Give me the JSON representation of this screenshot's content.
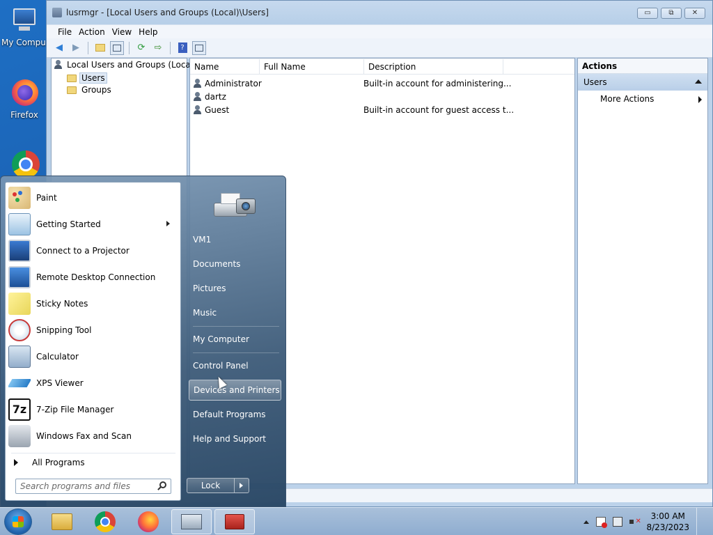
{
  "desktop": {
    "icons": [
      {
        "label": "My Computer",
        "icon": "computer-icon"
      },
      {
        "label": "Firefox",
        "icon": "firefox-icon"
      },
      {
        "label": "",
        "icon": "chrome-icon"
      }
    ]
  },
  "window": {
    "title": "lusrmgr - [Local Users and Groups (Local)\\Users]",
    "controls": {
      "minimize": "▭",
      "restore": "⧉",
      "close": "✕"
    },
    "menu": [
      "File",
      "Action",
      "View",
      "Help"
    ],
    "toolbar": [
      "back-icon",
      "forward-icon",
      "up-folder-icon",
      "show-tree-icon",
      "refresh-icon",
      "export-icon",
      "help-icon",
      "show-action-pane-icon"
    ]
  },
  "tree": {
    "root": "Local Users and Groups (Local)",
    "children": [
      "Users",
      "Groups"
    ],
    "selected": "Users"
  },
  "list": {
    "columns": [
      "Name",
      "Full Name",
      "Description"
    ],
    "rows": [
      {
        "name": "Administrator",
        "full_name": "",
        "description": "Built-in account for administering..."
      },
      {
        "name": "dartz",
        "full_name": "",
        "description": ""
      },
      {
        "name": "Guest",
        "full_name": "",
        "description": "Built-in account for guest access t..."
      }
    ]
  },
  "actions": {
    "header": "Actions",
    "section": "Users",
    "items": [
      "More Actions"
    ]
  },
  "start_menu": {
    "programs": [
      {
        "label": "Paint",
        "icon": "paint-icon",
        "submenu": false
      },
      {
        "label": "Getting Started",
        "icon": "getting-started-icon",
        "submenu": true
      },
      {
        "label": "Connect to a Projector",
        "icon": "projector-icon",
        "submenu": false
      },
      {
        "label": "Remote Desktop Connection",
        "icon": "remote-desktop-icon",
        "submenu": false
      },
      {
        "label": "Sticky Notes",
        "icon": "sticky-notes-icon",
        "submenu": false
      },
      {
        "label": "Snipping Tool",
        "icon": "snipping-tool-icon",
        "submenu": false
      },
      {
        "label": "Calculator",
        "icon": "calculator-icon",
        "submenu": false
      },
      {
        "label": "XPS Viewer",
        "icon": "xps-viewer-icon",
        "submenu": false
      },
      {
        "label": "7-Zip File Manager",
        "icon": "seven-zip-icon",
        "submenu": false
      },
      {
        "label": "Windows Fax and Scan",
        "icon": "fax-scan-icon",
        "submenu": false
      }
    ],
    "all_programs": "All Programs",
    "search_placeholder": "Search programs and files",
    "right_items": [
      "VM1",
      "Documents",
      "Pictures",
      "Music",
      "My Computer",
      "Control Panel",
      "Devices and Printers",
      "Default Programs",
      "Help and Support"
    ],
    "highlighted": "Devices and Printers",
    "lock_label": "Lock"
  },
  "taskbar": {
    "items": [
      "explorer-icon",
      "chrome-icon",
      "firefox-icon",
      "mmc-icon",
      "toolbox-icon"
    ],
    "active": "mmc-icon",
    "tray": [
      "show-hidden-icons-icon",
      "action-center-icon",
      "network-icon",
      "volume-icon"
    ],
    "time": "3:00 AM",
    "date": "8/23/2023"
  }
}
